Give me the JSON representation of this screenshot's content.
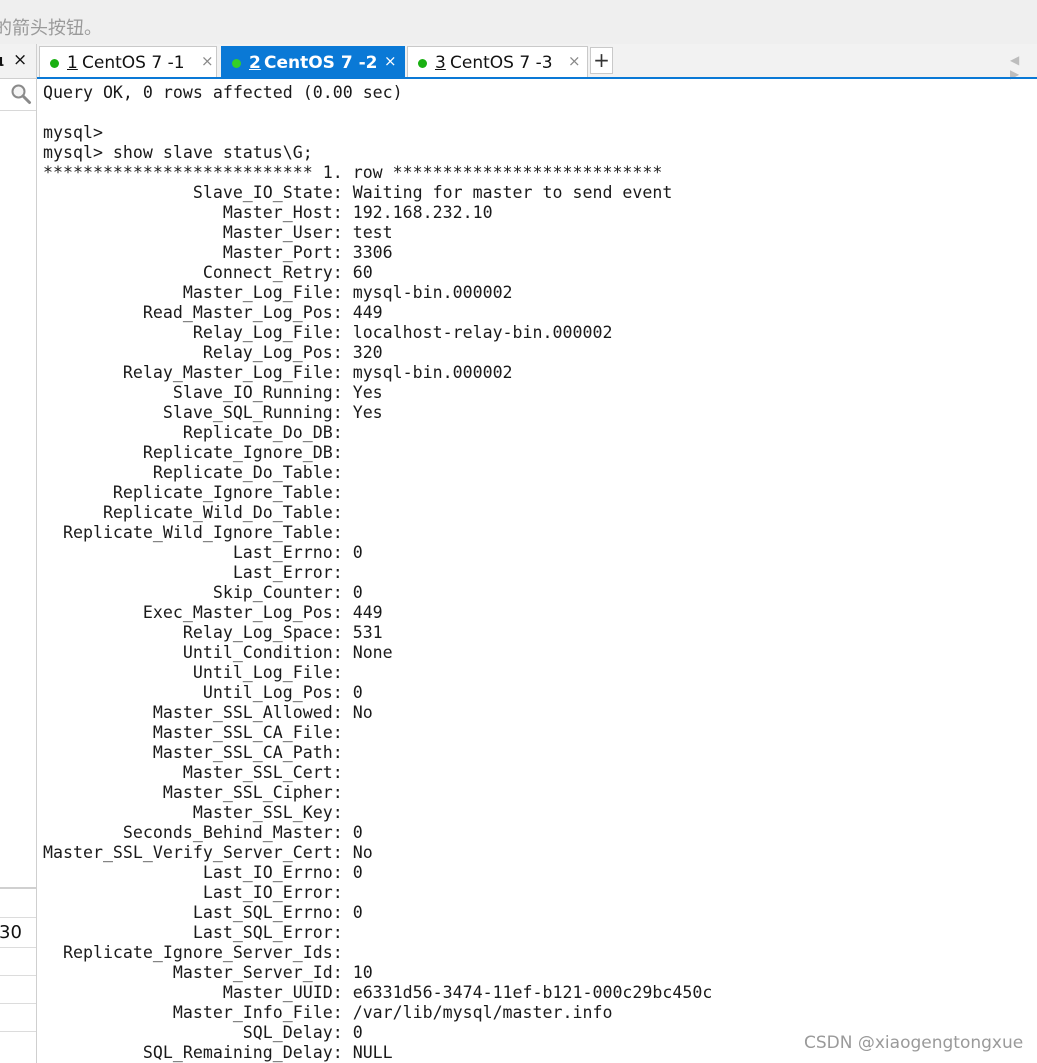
{
  "top_hint": "的箭头按钮。",
  "left_panel": {
    "tab_label": "ι",
    "tab_close": "×",
    "row_value": "30"
  },
  "tabs": [
    {
      "num": "1",
      "label": "CentOS 7 -1",
      "close": "×",
      "active": false
    },
    {
      "num": "2",
      "label": "CentOS 7 -2",
      "close": "×",
      "active": true
    },
    {
      "num": "3",
      "label": "CentOS 7 -3",
      "close": "×",
      "active": false
    }
  ],
  "add_tab": "+",
  "nav_arrows": "◀ ▶",
  "terminal_lines": [
    "Query OK, 0 rows affected (0.00 sec)",
    "",
    "mysql>",
    "mysql> show slave status\\G;",
    "*************************** 1. row ***************************",
    "               Slave_IO_State: Waiting for master to send event",
    "                  Master_Host: 192.168.232.10",
    "                  Master_User: test",
    "                  Master_Port: 3306",
    "                Connect_Retry: 60",
    "              Master_Log_File: mysql-bin.000002",
    "          Read_Master_Log_Pos: 449",
    "               Relay_Log_File: localhost-relay-bin.000002",
    "                Relay_Log_Pos: 320",
    "        Relay_Master_Log_File: mysql-bin.000002",
    "             Slave_IO_Running: Yes",
    "            Slave_SQL_Running: Yes",
    "              Replicate_Do_DB: ",
    "          Replicate_Ignore_DB: ",
    "           Replicate_Do_Table: ",
    "       Replicate_Ignore_Table: ",
    "      Replicate_Wild_Do_Table: ",
    "  Replicate_Wild_Ignore_Table: ",
    "                   Last_Errno: 0",
    "                   Last_Error: ",
    "                 Skip_Counter: 0",
    "          Exec_Master_Log_Pos: 449",
    "              Relay_Log_Space: 531",
    "              Until_Condition: None",
    "               Until_Log_File: ",
    "                Until_Log_Pos: 0",
    "           Master_SSL_Allowed: No",
    "           Master_SSL_CA_File: ",
    "           Master_SSL_CA_Path: ",
    "              Master_SSL_Cert: ",
    "            Master_SSL_Cipher: ",
    "               Master_SSL_Key: ",
    "        Seconds_Behind_Master: 0",
    "Master_SSL_Verify_Server_Cert: No",
    "                Last_IO_Errno: 0",
    "                Last_IO_Error: ",
    "               Last_SQL_Errno: 0",
    "               Last_SQL_Error: ",
    "  Replicate_Ignore_Server_Ids: ",
    "             Master_Server_Id: 10",
    "                  Master_UUID: e6331d56-3474-11ef-b121-000c29bc450c",
    "             Master_Info_File: /var/lib/mysql/master.info",
    "                    SQL_Delay: 0",
    "          SQL_Remaining_Delay: NULL"
  ],
  "watermark": "CSDN @xiaogengtongxue",
  "colors": {
    "accent": "#0a79d6",
    "status_dot": "#19b012"
  }
}
